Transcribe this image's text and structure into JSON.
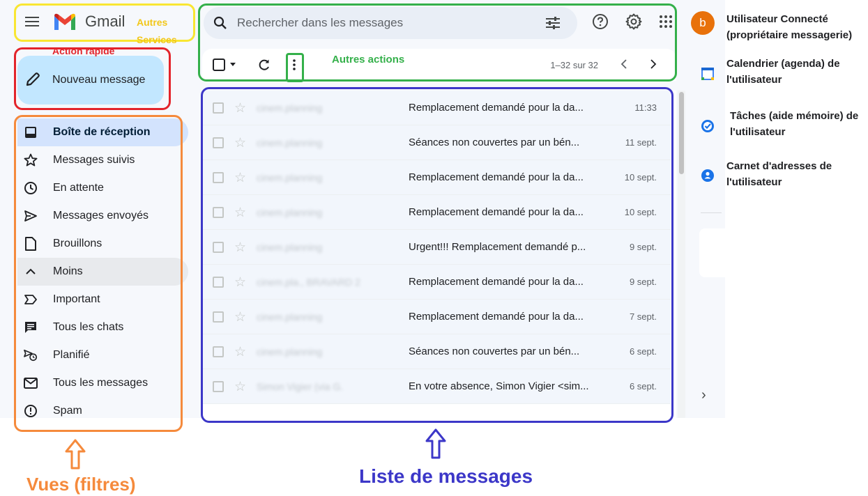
{
  "header": {
    "brand": "Gmail",
    "search_placeholder": "Rechercher dans les messages"
  },
  "compose": {
    "label": "Nouveau message"
  },
  "nav": {
    "items": [
      {
        "label": "Boîte de réception",
        "icon": "inbox-icon",
        "active": true
      },
      {
        "label": "Messages suivis",
        "icon": "star-icon"
      },
      {
        "label": "En attente",
        "icon": "clock-icon"
      },
      {
        "label": "Messages envoyés",
        "icon": "send-icon"
      },
      {
        "label": "Brouillons",
        "icon": "draft-icon"
      },
      {
        "label": "Moins",
        "icon": "chevron-up-icon"
      },
      {
        "label": "Important",
        "icon": "important-icon"
      },
      {
        "label": "Tous les chats",
        "icon": "chat-icon"
      },
      {
        "label": "Planifié",
        "icon": "scheduled-icon"
      },
      {
        "label": "Tous les messages",
        "icon": "mail-icon"
      },
      {
        "label": "Spam",
        "icon": "spam-icon"
      }
    ]
  },
  "toolbar": {
    "pager": "1–32 sur 32"
  },
  "messages": [
    {
      "sender": "cinem.planning",
      "subject": "Remplacement demandé pour la da...",
      "date": "11:33"
    },
    {
      "sender": "cinem.planning",
      "subject": "Séances non couvertes par un bén...",
      "date": "11 sept."
    },
    {
      "sender": "cinem.planning",
      "subject": "Remplacement demandé pour la da...",
      "date": "10 sept."
    },
    {
      "sender": "cinem.planning",
      "subject": "Remplacement demandé pour la da...",
      "date": "10 sept."
    },
    {
      "sender": "cinem.planning",
      "subject": "Urgent!!! Remplacement demandé p...",
      "date": "9 sept."
    },
    {
      "sender": "cinem.pla., BRAVARD 2",
      "subject": "Remplacement demandé pour la da...",
      "date": "9 sept."
    },
    {
      "sender": "cinem.planning",
      "subject": "Remplacement demandé pour la da...",
      "date": "7 sept."
    },
    {
      "sender": "cinem.planning",
      "subject": "Séances non couvertes par un bén...",
      "date": "6 sept."
    },
    {
      "sender": "Simon Vigier (via G.",
      "subject": "En votre absence, Simon Vigier <sim...",
      "date": "6 sept."
    }
  ],
  "side_panel": {
    "avatar_letter": "b"
  },
  "annotations": {
    "autres_services": "Autres Services",
    "action_rapide": "Action rapide",
    "autres_actions": "Autres actions",
    "vues": "Vues (filtres)",
    "liste": "Liste de messages",
    "utilisateur": "Utilisateur Connecté (propriétaire messagerie)",
    "calendrier": "Calendrier (agenda) de l'utilisateur",
    "taches": "Tâches (aide mémoire) de l'utilisateur",
    "carnet": "Carnet d'adresses de l'utilisateur"
  },
  "colors": {
    "annotation_yellow": "#f9e632",
    "annotation_red": "#e3242b",
    "annotation_orange": "#f58a3c",
    "annotation_green": "#34b04a",
    "annotation_blue": "#3c37c8",
    "compose_bg": "#c2e7ff",
    "active_nav_bg": "#d3e3fd"
  }
}
